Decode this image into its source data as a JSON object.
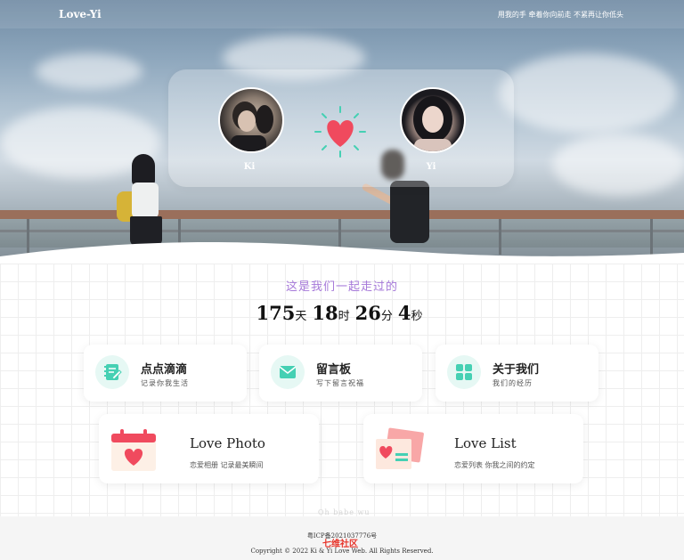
{
  "nav": {
    "brand": "Love-Yi",
    "motto": "用我的手 牵着你向前走 不紧再让你低头"
  },
  "couple": {
    "left_name": "Ki",
    "right_name": "Yi"
  },
  "together": {
    "caption": "这是我们一起走过的",
    "days": "175",
    "days_unit": "天",
    "hours": "18",
    "hours_unit": "时",
    "minutes": "26",
    "minutes_unit": "分",
    "seconds": "4",
    "seconds_unit": "秒"
  },
  "cards": [
    {
      "title": "点点滴滴",
      "subtitle": "记录你我生活",
      "icon": "notepad-icon"
    },
    {
      "title": "留言板",
      "subtitle": "写下留言祝福",
      "icon": "mail-icon"
    },
    {
      "title": "关于我们",
      "subtitle": "我们的经历",
      "icon": "grid-icon"
    }
  ],
  "big_cards": [
    {
      "title": "Love Photo",
      "subtitle": "恋爱相册 记录最美瞬间",
      "icon": "calendar-heart-icon"
    },
    {
      "title": "Love List",
      "subtitle": "恋爱列表 你我之间的约定",
      "icon": "photos-heart-icon"
    }
  ],
  "faint_text": "Oh babe wu",
  "footer": {
    "icp": "粤ICP备2021037776号",
    "watermark": "七维社区",
    "copyright": "Copyright © 2022 Ki & Yi Love Web. All Rights Reserved."
  },
  "colors": {
    "accent_purple": "#a679d9",
    "heart_red": "#f04a5e",
    "icon_teal": "#45d0b3",
    "icon_bg": "#e6f8f4"
  }
}
